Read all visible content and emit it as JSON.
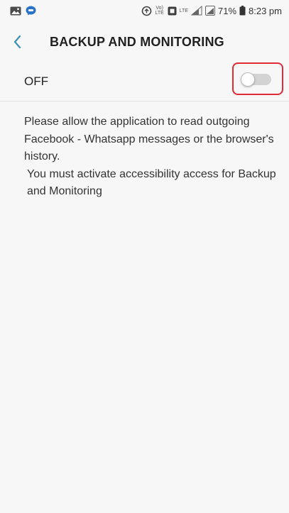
{
  "status_bar": {
    "battery_percent": "71%",
    "time": "8:23 pm",
    "icons": [
      "image-icon",
      "messenger-icon",
      "data-saver-icon",
      "volte-icon",
      "nfc-icon",
      "lte-signal-icon",
      "battery-icon"
    ],
    "volte_label": "Vo) LTE",
    "lte_label": "LTE"
  },
  "app_bar": {
    "title": "BACKUP AND MONITORING",
    "back_icon": "chevron-left-icon"
  },
  "toggle": {
    "label": "OFF",
    "state": "off"
  },
  "description": {
    "line1": "Please allow the application to read outgoing Facebook - Whatsapp messages or the browser's history.",
    "line2": "You must activate accessibility access for Backup and Monitoring"
  },
  "colors": {
    "background": "#f7f7f7",
    "highlight": "#e02a36",
    "back_chevron": "#3b8fb8",
    "toggle_track_off": "#d3d3d3"
  }
}
